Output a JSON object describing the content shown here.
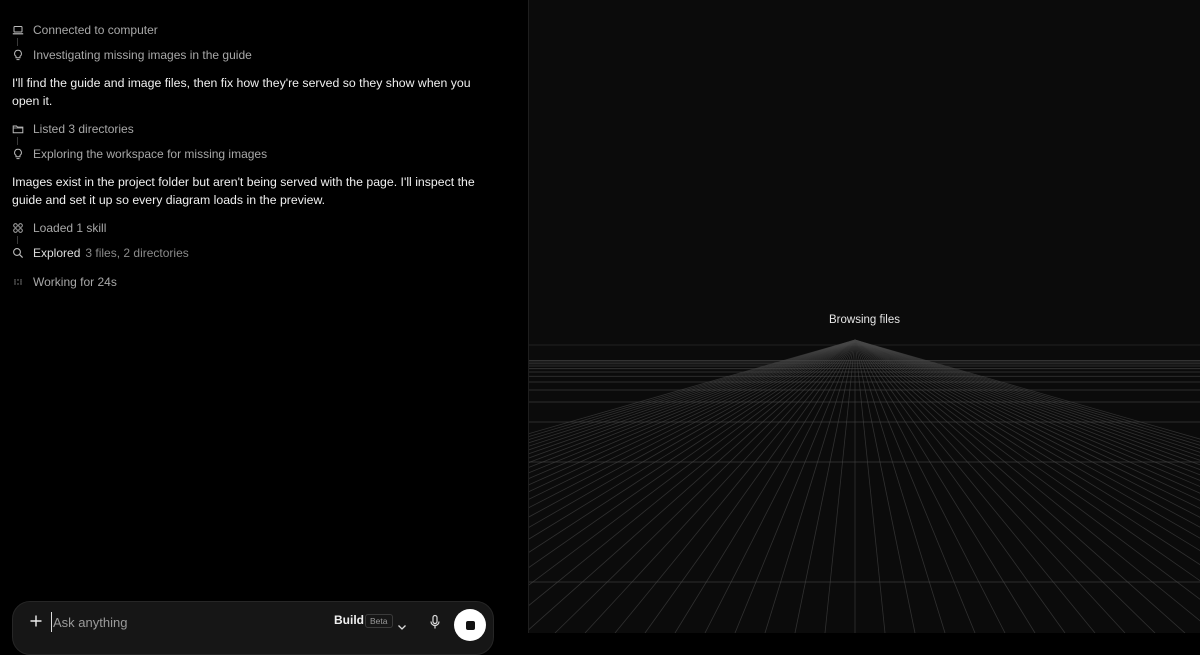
{
  "steps": {
    "connected": "Connected to computer",
    "investigating": "Investigating missing images in the guide",
    "listed": "Listed 3 directories",
    "exploring": "Exploring the workspace for missing images",
    "loaded": "Loaded 1 skill",
    "explored_label": "Explored",
    "explored_detail": "3 files, 2 directories",
    "working": "Working for 24s"
  },
  "messages": {
    "first": "I'll find the guide and image files, then fix how they're served so they show when you open it.",
    "second": "Images exist in the project folder but aren't being served with the page. I'll inspect the guide and set it up so every diagram loads in the preview."
  },
  "composer": {
    "placeholder": "Ask anything",
    "value": "",
    "mode_label": "Build",
    "beta_label": "Beta"
  },
  "preview": {
    "status": "Browsing files"
  },
  "icons": {
    "connected": "laptop-icon",
    "investigating": "lightbulb-icon",
    "listed": "folder-icon",
    "exploring": "lightbulb-icon",
    "loaded": "grid-icon",
    "explored": "search-icon",
    "working": "dots-spinner-icon",
    "add": "plus-icon",
    "mode_menu": "chevron-down-icon",
    "voice": "microphone-icon",
    "stop": "stop-icon"
  },
  "colors": {
    "background": "#000000",
    "preview_background": "#0b0b0b",
    "grid_line": "#4a4a4a",
    "stop_button": "#ffffff"
  }
}
